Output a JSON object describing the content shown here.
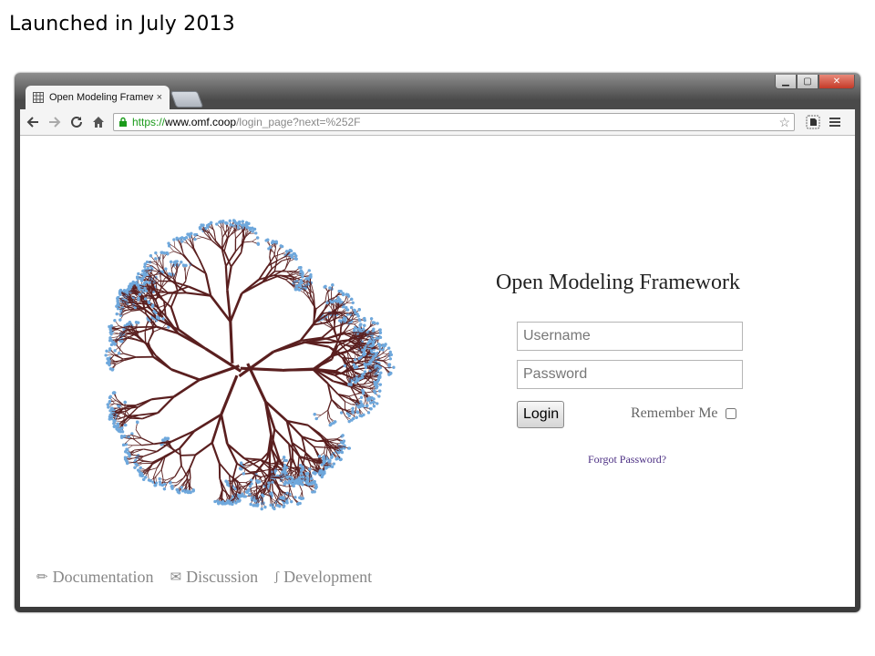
{
  "slide": {
    "caption": "Launched in July 2013"
  },
  "browser": {
    "tab_title": "Open Modeling Framewo",
    "tab_close": "×",
    "window_controls": {
      "minimize": "▁",
      "maximize": "▢",
      "close": "✕"
    },
    "url": {
      "scheme": "https://",
      "host": "www.omf.coop",
      "path": "/login_page?next=%252F"
    },
    "icons": {
      "back": "back-arrow-icon",
      "forward": "forward-arrow-icon",
      "reload": "reload-icon",
      "home": "home-icon",
      "lock": "lock-icon",
      "star": "star-icon",
      "extension": "evernote-icon",
      "menu": "menu-icon"
    }
  },
  "page": {
    "title": "Open Modeling Framework",
    "username_placeholder": "Username",
    "password_placeholder": "Password",
    "login_label": "Login",
    "remember_label": "Remember Me",
    "forgot_label": "Forgot Password?",
    "footer": [
      {
        "label": "Documentation",
        "icon": "pencil-icon"
      },
      {
        "label": "Discussion",
        "icon": "envelope-icon"
      },
      {
        "label": "Development",
        "icon": "code-fork-icon"
      }
    ]
  },
  "colors": {
    "tree_branch": "#5a1f1f",
    "tree_leaf": "#6fa8dc",
    "link": "#4b2e83",
    "url_scheme": "#1a9b1a"
  }
}
